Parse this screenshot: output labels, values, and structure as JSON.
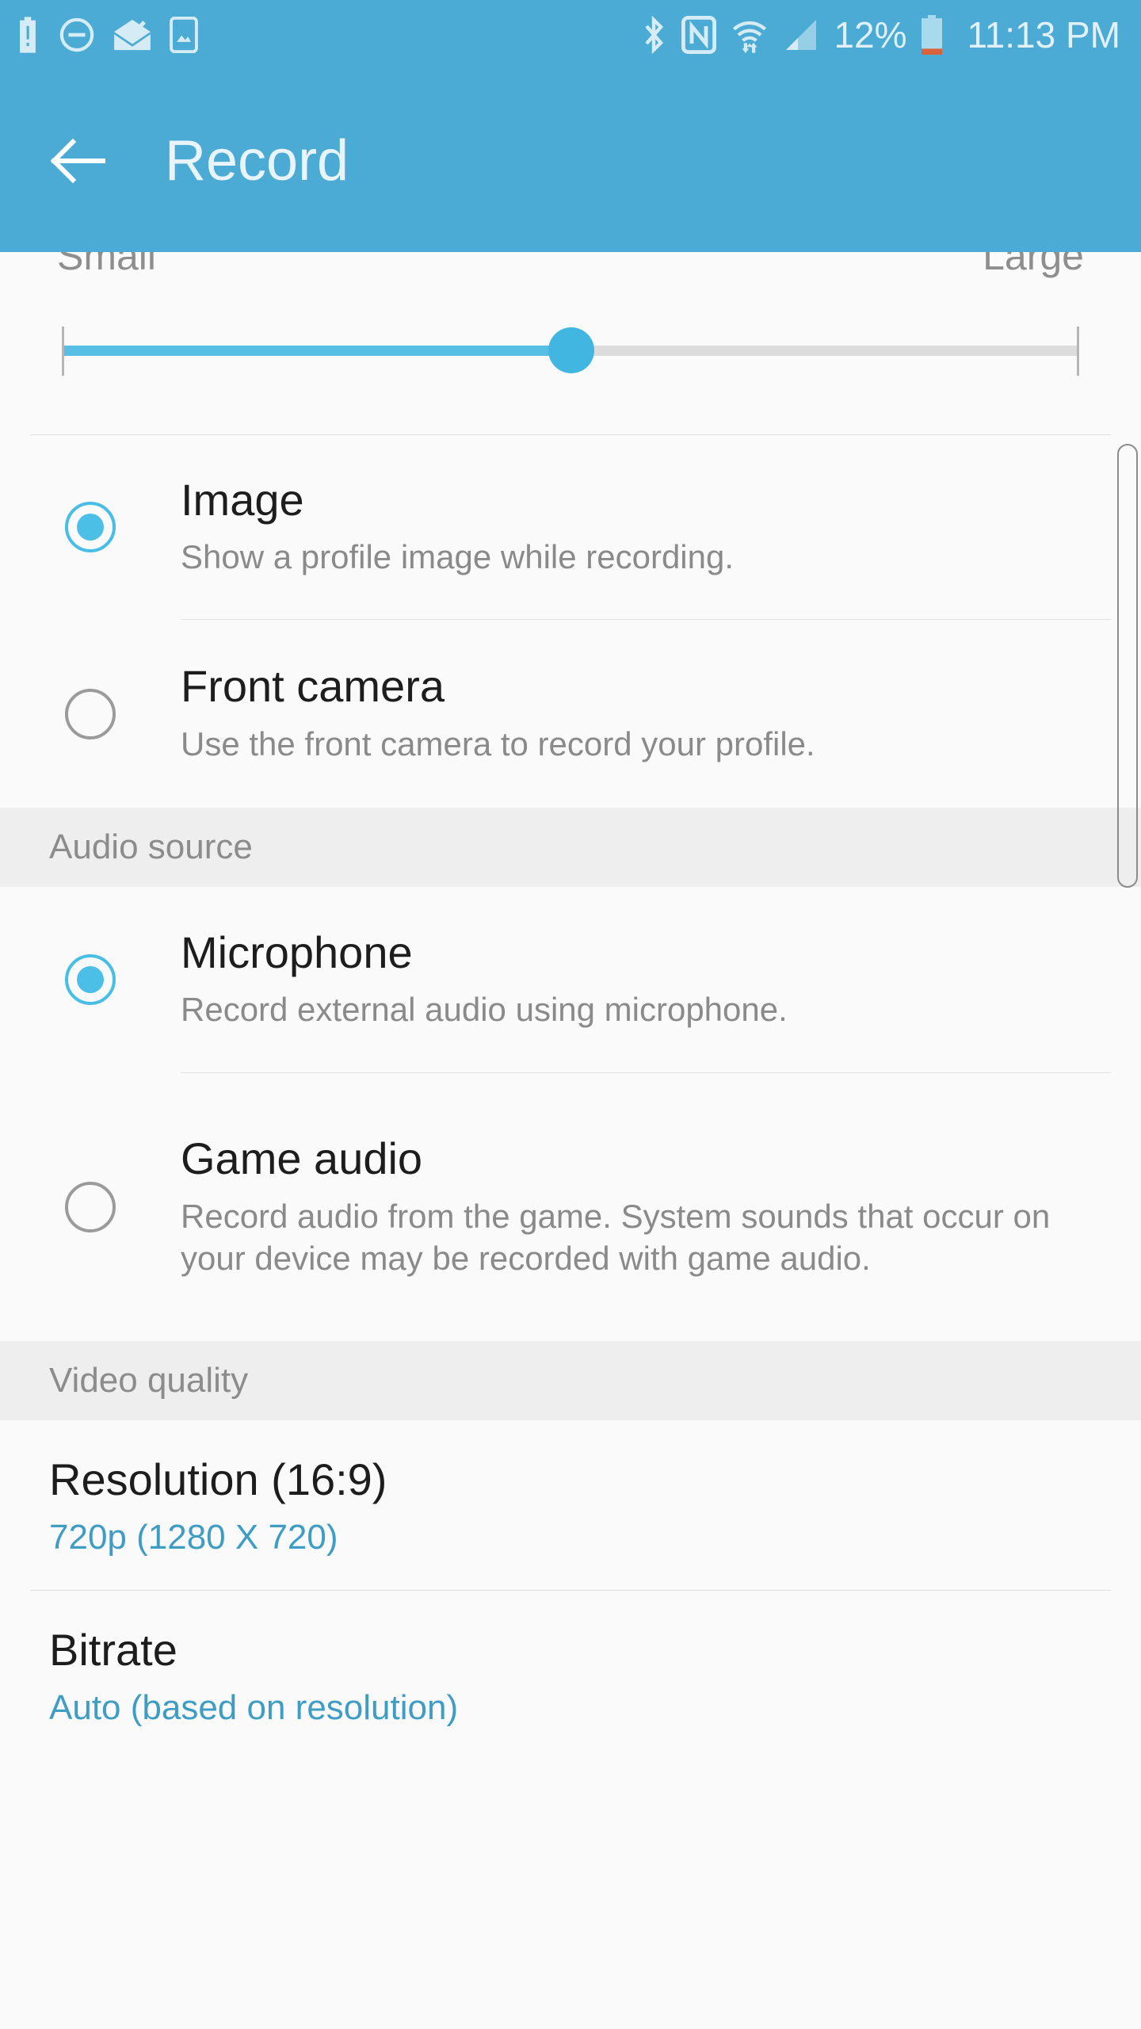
{
  "statusbar": {
    "icons_left": [
      "battery-alert-icon",
      "do-not-disturb-icon",
      "mail-read-icon",
      "screenshot-icon"
    ],
    "icons_right": [
      "bluetooth-icon",
      "nfc-icon",
      "wifi-icon",
      "cellular-signal-icon"
    ],
    "battery_percent": "12%",
    "time": "11:13 PM",
    "battery_low_color": "#d9613c",
    "bar_color": "#4cabd4",
    "icon_color": "#d5ecf6"
  },
  "appbar": {
    "back_icon": "arrow-left-icon",
    "title": "Record"
  },
  "size_slider": {
    "min_label": "Small",
    "max_label": "Large",
    "value_percent": 50,
    "fill_color": "#56bfe3",
    "track_color": "#dcdcdc"
  },
  "profile_options": [
    {
      "title": "Image",
      "subtitle": "Show a profile image while recording.",
      "selected": true
    },
    {
      "title": "Front camera",
      "subtitle": "Use the front camera to record your profile.",
      "selected": false
    }
  ],
  "audio_section": {
    "header": "Audio source",
    "options": [
      {
        "title": "Microphone",
        "subtitle": "Record external audio using microphone.",
        "selected": true
      },
      {
        "title": "Game audio",
        "subtitle": "Record audio from the game. System sounds that occur on your device may be recorded with game audio.",
        "selected": false
      }
    ]
  },
  "video_section": {
    "header": "Video quality",
    "items": [
      {
        "title": "Resolution (16:9)",
        "value": "720p (1280 X 720)"
      },
      {
        "title": "Bitrate",
        "value": "Auto (based on resolution)"
      }
    ]
  },
  "theme": {
    "accent": "#4cabd4",
    "link_text": "#3f9dc4",
    "radio_on": "#4bbfe6",
    "background": "#fafafa",
    "section_band": "#eeeeee"
  }
}
